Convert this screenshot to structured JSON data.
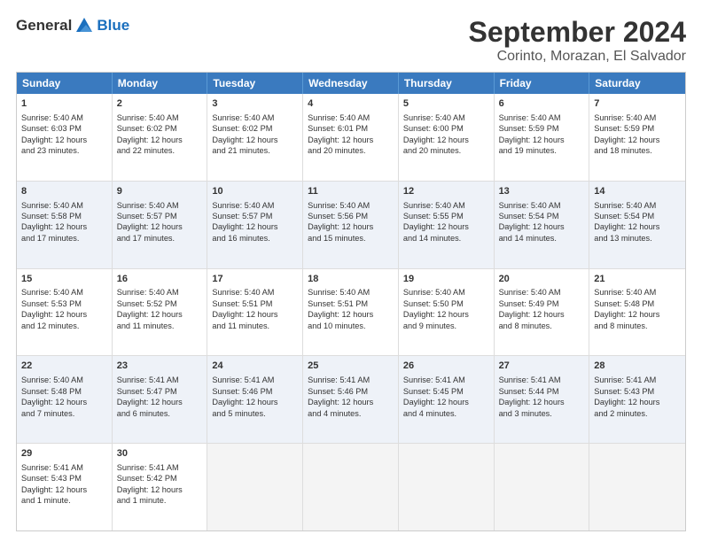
{
  "logo": {
    "general": "General",
    "blue": "Blue"
  },
  "title": "September 2024",
  "subtitle": "Corinto, Morazan, El Salvador",
  "header_days": [
    "Sunday",
    "Monday",
    "Tuesday",
    "Wednesday",
    "Thursday",
    "Friday",
    "Saturday"
  ],
  "rows": [
    [
      {
        "day": "1",
        "lines": [
          "Sunrise: 5:40 AM",
          "Sunset: 6:03 PM",
          "Daylight: 12 hours",
          "and 23 minutes."
        ]
      },
      {
        "day": "2",
        "lines": [
          "Sunrise: 5:40 AM",
          "Sunset: 6:02 PM",
          "Daylight: 12 hours",
          "and 22 minutes."
        ]
      },
      {
        "day": "3",
        "lines": [
          "Sunrise: 5:40 AM",
          "Sunset: 6:02 PM",
          "Daylight: 12 hours",
          "and 21 minutes."
        ]
      },
      {
        "day": "4",
        "lines": [
          "Sunrise: 5:40 AM",
          "Sunset: 6:01 PM",
          "Daylight: 12 hours",
          "and 20 minutes."
        ]
      },
      {
        "day": "5",
        "lines": [
          "Sunrise: 5:40 AM",
          "Sunset: 6:00 PM",
          "Daylight: 12 hours",
          "and 20 minutes."
        ]
      },
      {
        "day": "6",
        "lines": [
          "Sunrise: 5:40 AM",
          "Sunset: 5:59 PM",
          "Daylight: 12 hours",
          "and 19 minutes."
        ]
      },
      {
        "day": "7",
        "lines": [
          "Sunrise: 5:40 AM",
          "Sunset: 5:59 PM",
          "Daylight: 12 hours",
          "and 18 minutes."
        ]
      }
    ],
    [
      {
        "day": "8",
        "lines": [
          "Sunrise: 5:40 AM",
          "Sunset: 5:58 PM",
          "Daylight: 12 hours",
          "and 17 minutes."
        ]
      },
      {
        "day": "9",
        "lines": [
          "Sunrise: 5:40 AM",
          "Sunset: 5:57 PM",
          "Daylight: 12 hours",
          "and 17 minutes."
        ]
      },
      {
        "day": "10",
        "lines": [
          "Sunrise: 5:40 AM",
          "Sunset: 5:57 PM",
          "Daylight: 12 hours",
          "and 16 minutes."
        ]
      },
      {
        "day": "11",
        "lines": [
          "Sunrise: 5:40 AM",
          "Sunset: 5:56 PM",
          "Daylight: 12 hours",
          "and 15 minutes."
        ]
      },
      {
        "day": "12",
        "lines": [
          "Sunrise: 5:40 AM",
          "Sunset: 5:55 PM",
          "Daylight: 12 hours",
          "and 14 minutes."
        ]
      },
      {
        "day": "13",
        "lines": [
          "Sunrise: 5:40 AM",
          "Sunset: 5:54 PM",
          "Daylight: 12 hours",
          "and 14 minutes."
        ]
      },
      {
        "day": "14",
        "lines": [
          "Sunrise: 5:40 AM",
          "Sunset: 5:54 PM",
          "Daylight: 12 hours",
          "and 13 minutes."
        ]
      }
    ],
    [
      {
        "day": "15",
        "lines": [
          "Sunrise: 5:40 AM",
          "Sunset: 5:53 PM",
          "Daylight: 12 hours",
          "and 12 minutes."
        ]
      },
      {
        "day": "16",
        "lines": [
          "Sunrise: 5:40 AM",
          "Sunset: 5:52 PM",
          "Daylight: 12 hours",
          "and 11 minutes."
        ]
      },
      {
        "day": "17",
        "lines": [
          "Sunrise: 5:40 AM",
          "Sunset: 5:51 PM",
          "Daylight: 12 hours",
          "and 11 minutes."
        ]
      },
      {
        "day": "18",
        "lines": [
          "Sunrise: 5:40 AM",
          "Sunset: 5:51 PM",
          "Daylight: 12 hours",
          "and 10 minutes."
        ]
      },
      {
        "day": "19",
        "lines": [
          "Sunrise: 5:40 AM",
          "Sunset: 5:50 PM",
          "Daylight: 12 hours",
          "and 9 minutes."
        ]
      },
      {
        "day": "20",
        "lines": [
          "Sunrise: 5:40 AM",
          "Sunset: 5:49 PM",
          "Daylight: 12 hours",
          "and 8 minutes."
        ]
      },
      {
        "day": "21",
        "lines": [
          "Sunrise: 5:40 AM",
          "Sunset: 5:48 PM",
          "Daylight: 12 hours",
          "and 8 minutes."
        ]
      }
    ],
    [
      {
        "day": "22",
        "lines": [
          "Sunrise: 5:40 AM",
          "Sunset: 5:48 PM",
          "Daylight: 12 hours",
          "and 7 minutes."
        ]
      },
      {
        "day": "23",
        "lines": [
          "Sunrise: 5:41 AM",
          "Sunset: 5:47 PM",
          "Daylight: 12 hours",
          "and 6 minutes."
        ]
      },
      {
        "day": "24",
        "lines": [
          "Sunrise: 5:41 AM",
          "Sunset: 5:46 PM",
          "Daylight: 12 hours",
          "and 5 minutes."
        ]
      },
      {
        "day": "25",
        "lines": [
          "Sunrise: 5:41 AM",
          "Sunset: 5:46 PM",
          "Daylight: 12 hours",
          "and 4 minutes."
        ]
      },
      {
        "day": "26",
        "lines": [
          "Sunrise: 5:41 AM",
          "Sunset: 5:45 PM",
          "Daylight: 12 hours",
          "and 4 minutes."
        ]
      },
      {
        "day": "27",
        "lines": [
          "Sunrise: 5:41 AM",
          "Sunset: 5:44 PM",
          "Daylight: 12 hours",
          "and 3 minutes."
        ]
      },
      {
        "day": "28",
        "lines": [
          "Sunrise: 5:41 AM",
          "Sunset: 5:43 PM",
          "Daylight: 12 hours",
          "and 2 minutes."
        ]
      }
    ],
    [
      {
        "day": "29",
        "lines": [
          "Sunrise: 5:41 AM",
          "Sunset: 5:43 PM",
          "Daylight: 12 hours",
          "and 1 minute."
        ]
      },
      {
        "day": "30",
        "lines": [
          "Sunrise: 5:41 AM",
          "Sunset: 5:42 PM",
          "Daylight: 12 hours",
          "and 1 minute."
        ]
      },
      {
        "day": "",
        "lines": []
      },
      {
        "day": "",
        "lines": []
      },
      {
        "day": "",
        "lines": []
      },
      {
        "day": "",
        "lines": []
      },
      {
        "day": "",
        "lines": []
      }
    ]
  ]
}
